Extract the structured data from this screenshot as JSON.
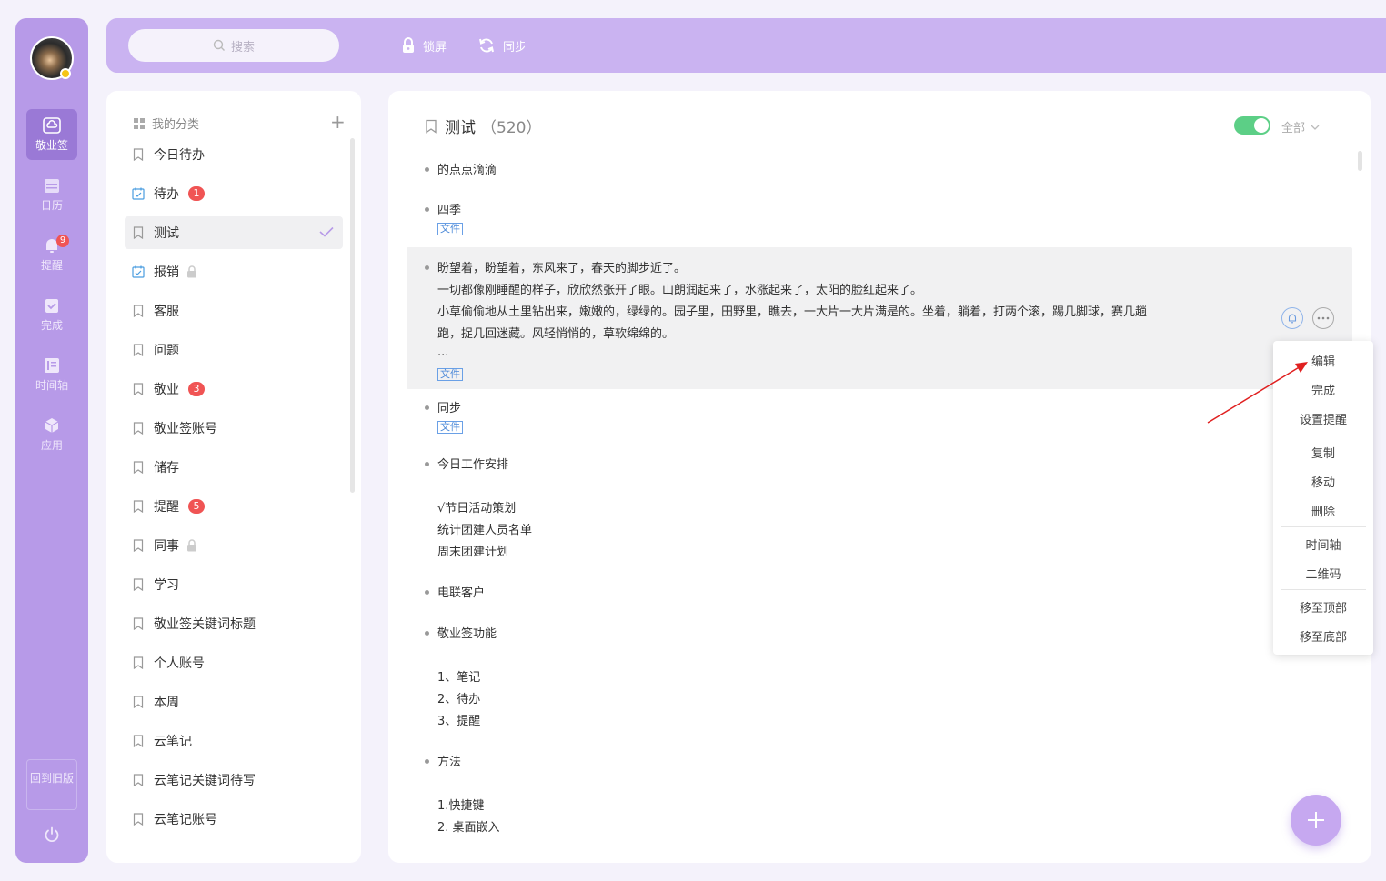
{
  "rail": {
    "items": [
      {
        "label": "敬业签",
        "icon": "cloud-note-icon"
      },
      {
        "label": "日历",
        "icon": "calendar-icon"
      },
      {
        "label": "提醒",
        "icon": "bell-icon",
        "badge": "9"
      },
      {
        "label": "完成",
        "icon": "done-icon"
      },
      {
        "label": "时间轴",
        "icon": "timeline-icon"
      },
      {
        "label": "应用",
        "icon": "app-icon"
      }
    ],
    "old_version": "回到旧版"
  },
  "topbar": {
    "search_placeholder": "搜索",
    "lock_label": "锁屏",
    "sync_label": "同步"
  },
  "categories": {
    "header": "我的分类",
    "items": [
      {
        "label": "今日待办"
      },
      {
        "label": "待办",
        "badge": "1",
        "type": "todo"
      },
      {
        "label": "测试",
        "active": true
      },
      {
        "label": "报销",
        "type": "todo",
        "locked": true
      },
      {
        "label": "客服"
      },
      {
        "label": "问题"
      },
      {
        "label": "敬业",
        "badge": "3"
      },
      {
        "label": "敬业签账号"
      },
      {
        "label": "储存"
      },
      {
        "label": "提醒",
        "badge": "5"
      },
      {
        "label": "同事",
        "locked": true
      },
      {
        "label": "学习"
      },
      {
        "label": "敬业签关键词标题"
      },
      {
        "label": "个人账号"
      },
      {
        "label": "本周"
      },
      {
        "label": "云笔记"
      },
      {
        "label": "云笔记关键词待写"
      },
      {
        "label": "云笔记账号"
      }
    ]
  },
  "main": {
    "title": "测试",
    "count": "（520）",
    "filter": "全部",
    "file_tag": "文件",
    "notes": [
      {
        "lines": [
          "的点点滴滴"
        ]
      },
      {
        "lines": [
          "四季"
        ],
        "file": true
      },
      {
        "lines": [
          "盼望着，盼望着，东风来了，春天的脚步近了。",
          "一切都像刚睡醒的样子，欣欣然张开了眼。山朗润起来了，水涨起来了，太阳的脸红起来了。",
          "小草偷偷地从土里钻出来，嫩嫩的，绿绿的。园子里，田野里，瞧去，一大片一大片满是的。坐着，躺着，打两个滚，踢几脚球，赛几趟",
          "跑，捉几回迷藏。风轻悄悄的，草软绵绵的。",
          "..."
        ],
        "file": true,
        "highlighted": true
      },
      {
        "lines": [
          "同步"
        ],
        "file": true
      },
      {
        "lines": [
          "今日工作安排",
          "",
          "√节日活动策划",
          "统计团建人员名单",
          "周末团建计划"
        ]
      },
      {
        "lines": [
          "电联客户"
        ]
      },
      {
        "lines": [
          "敬业签功能",
          "",
          "1、笔记",
          "2、待办",
          "3、提醒"
        ]
      },
      {
        "lines": [
          "方法",
          "",
          "1.快捷键",
          "2. 桌面嵌入"
        ]
      }
    ]
  },
  "context_menu": {
    "items": [
      "编辑",
      "完成",
      "设置提醒",
      "复制",
      "移动",
      "删除",
      "时间轴",
      "二维码",
      "移至顶部",
      "移至底部"
    ]
  },
  "colors": {
    "rail": "#b79ae8",
    "topbar": "#cab3f1",
    "toggle_on": "#5ccf86",
    "badge": "#f05454",
    "annotation_arrow": "#e02020"
  }
}
